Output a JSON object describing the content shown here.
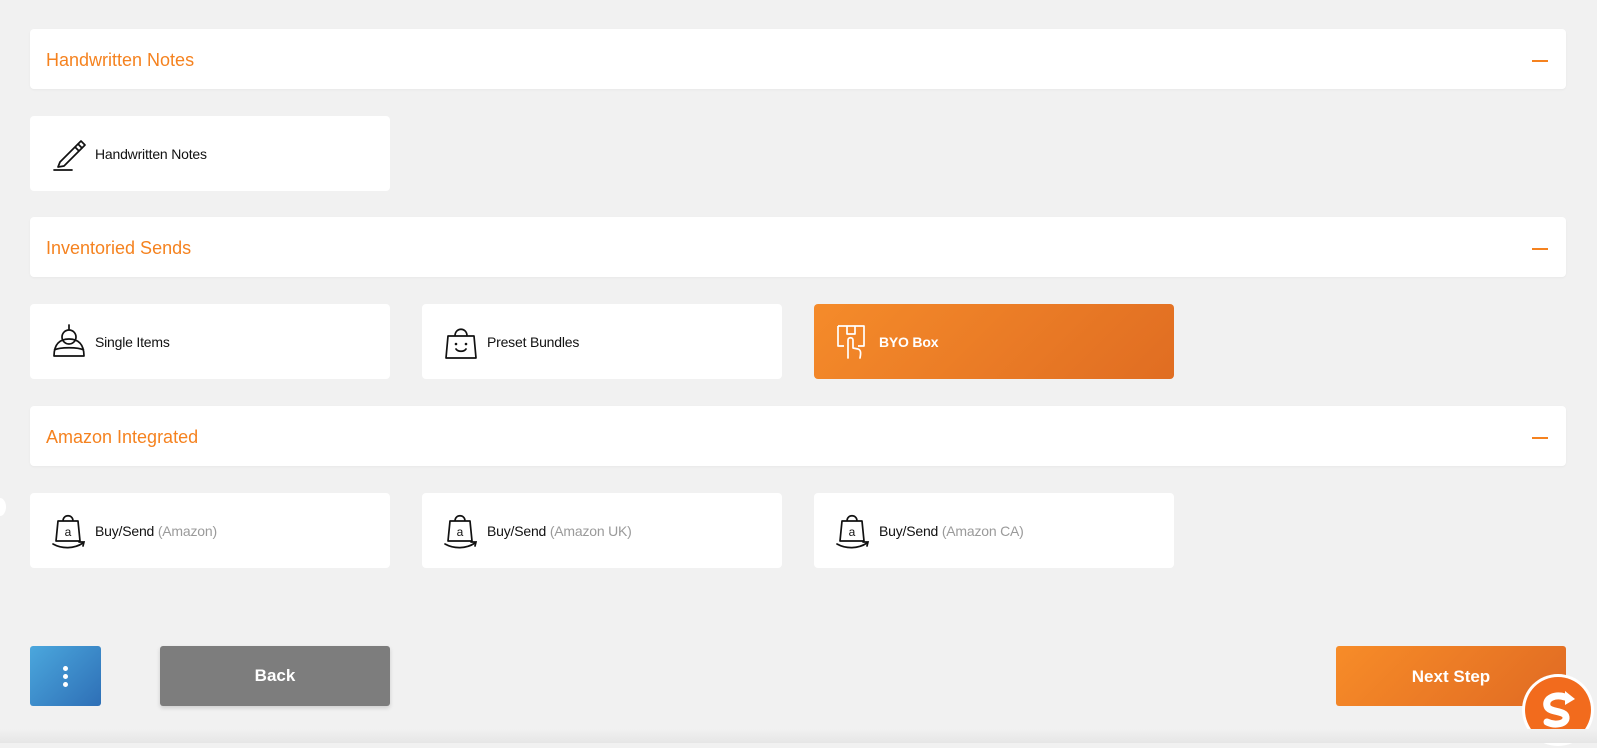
{
  "sections": [
    {
      "title": "Handwritten Notes",
      "cards": [
        {
          "label": "Handwritten Notes",
          "sub": "",
          "icon": "pen-icon"
        }
      ]
    },
    {
      "title": "Inventoried Sends",
      "cards": [
        {
          "label": "Single Items",
          "sub": "",
          "icon": "cap-icon"
        },
        {
          "label": "Preset Bundles",
          "sub": "",
          "icon": "shopping-bag-icon"
        },
        {
          "label": "BYO Box",
          "sub": "",
          "icon": "box-hand-icon",
          "selected": true
        }
      ]
    },
    {
      "title": "Amazon Integrated",
      "cards": [
        {
          "label": "Buy/Send",
          "sub": "(Amazon)",
          "icon": "amazon-bag-icon"
        },
        {
          "label": "Buy/Send",
          "sub": "(Amazon UK)",
          "icon": "amazon-bag-icon"
        },
        {
          "label": "Buy/Send",
          "sub": "(Amazon CA)",
          "icon": "amazon-bag-icon"
        }
      ]
    }
  ],
  "footer": {
    "back_label": "Back",
    "next_label": "Next Step"
  },
  "colors": {
    "accent": "#f5821f",
    "selected_gradient_start": "#f58b2a",
    "selected_gradient_end": "#e06d22",
    "menu_button": "#3a8ccc",
    "back_button": "#7d7d7d"
  }
}
